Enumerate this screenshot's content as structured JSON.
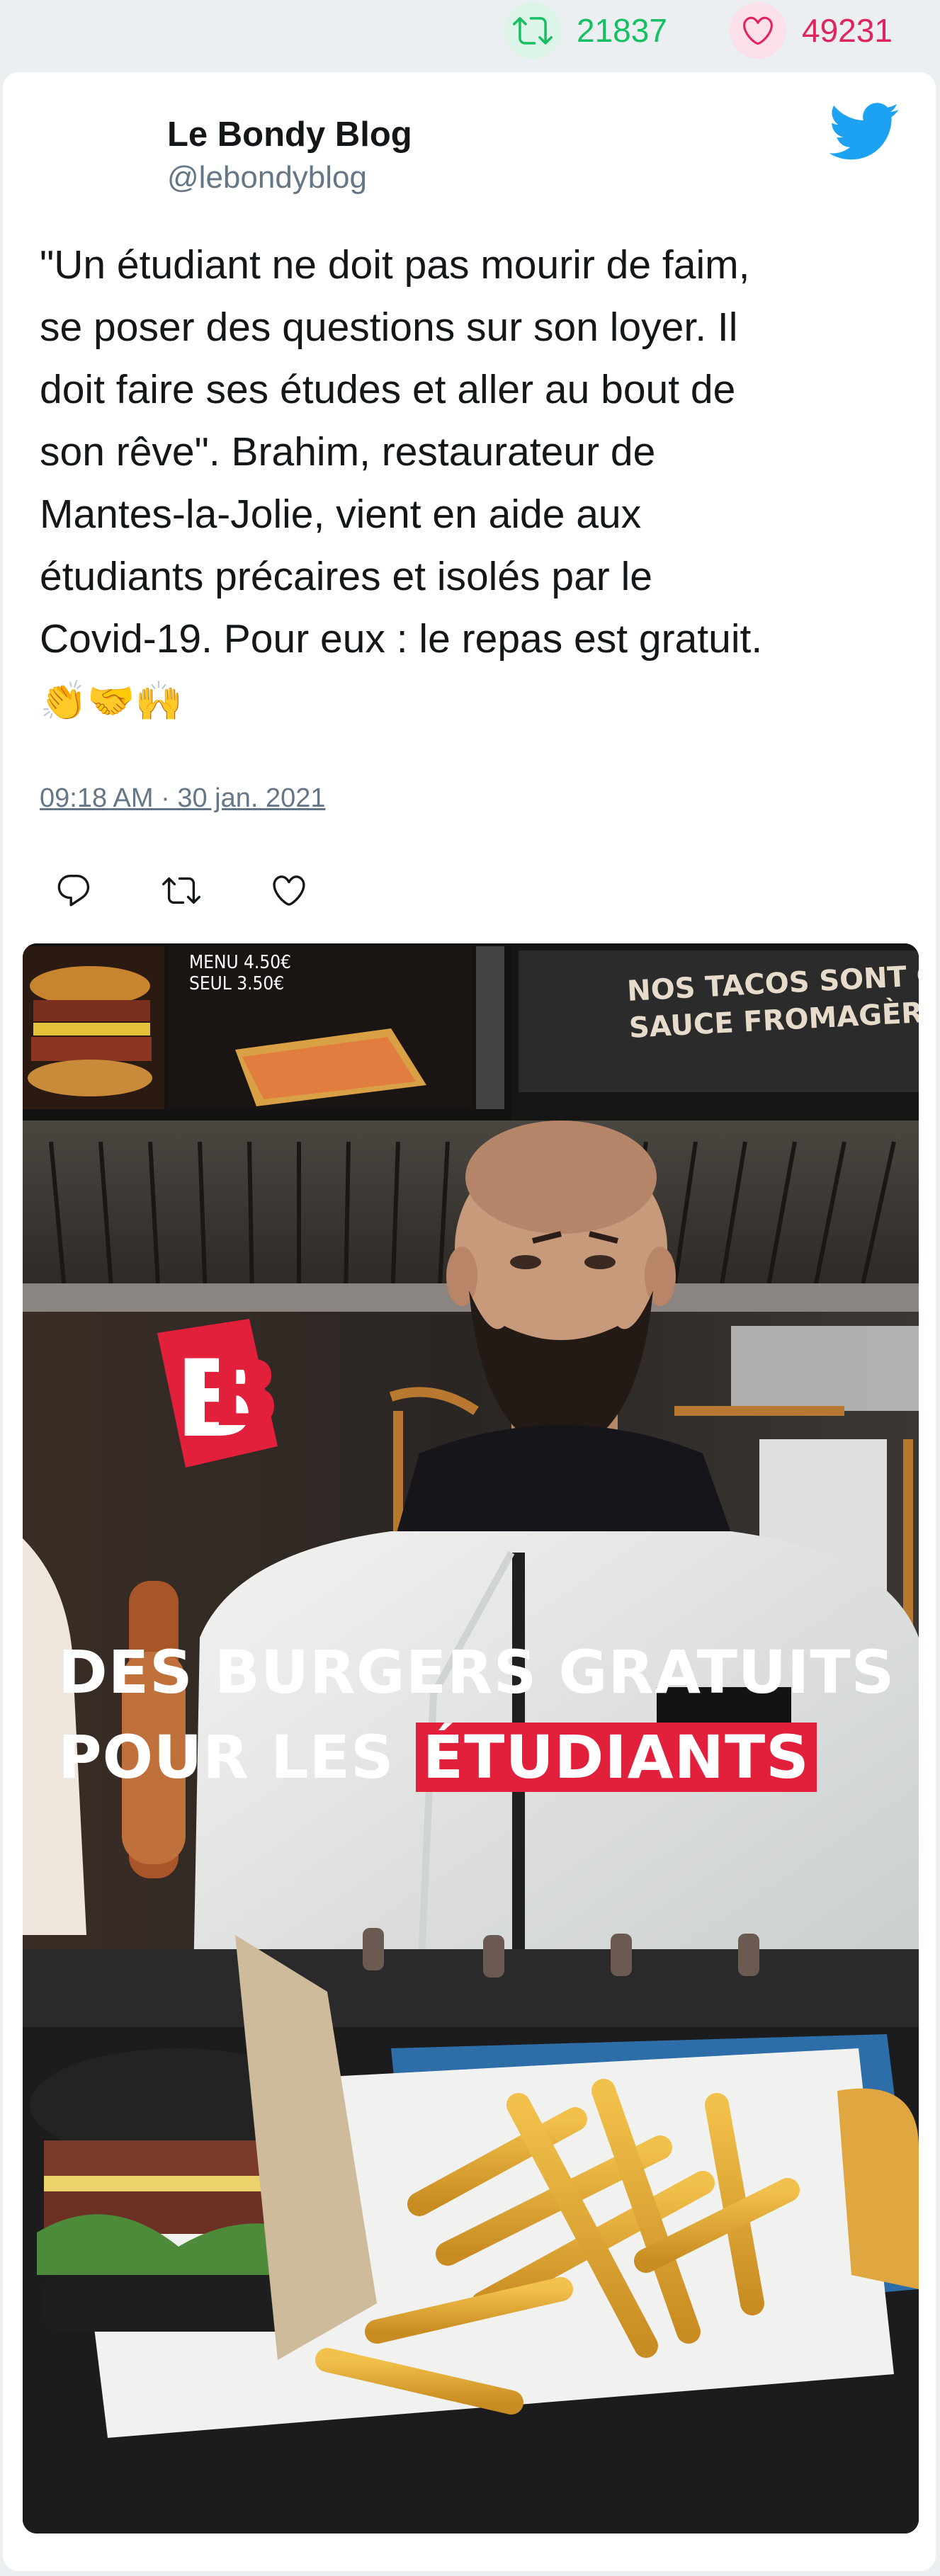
{
  "stats": {
    "retweets": "21837",
    "likes": "49231",
    "retweet_color": "#17bf63",
    "like_color": "#e0245e"
  },
  "author": {
    "name": "Le Bondy Blog",
    "handle": "@lebondyblog"
  },
  "tweet": {
    "lines": [
      "\"Un étudiant ne doit pas mourir de faim,",
      "se poser des questions sur son loyer. Il",
      "doit faire ses études et aller au bout de",
      "son rêve\". Brahim, restaurateur de",
      "Mantes-la-Jolie, vient en aide aux",
      "étudiants précaires et isolés par le",
      "Covid-19. Pour eux : le repas est gratuit."
    ],
    "emojis": "👏🤝🙌",
    "timestamp": "09:18 AM · 30 jan. 2021"
  },
  "actions": [
    {
      "icon": "reply-icon"
    },
    {
      "icon": "retweet-icon"
    },
    {
      "icon": "like-icon"
    }
  ],
  "media": {
    "overlay_line1": "DES BURGERS GRATUITS",
    "overlay_line2_prefix": "POUR LES",
    "overlay_line2_highlight": "ÉTUDIANTS",
    "logo_text": "BB",
    "menu_price_1": "MENU 4.50€",
    "menu_price_2": "SEUL 3.50€",
    "sign_line1": "NOS TACOS SONT GARNIS D'",
    "sign_line2": "SAUCE FROMAGÈRE MAISON",
    "highlight_color": "#e3203c"
  },
  "brand_color": "#1da1f2"
}
